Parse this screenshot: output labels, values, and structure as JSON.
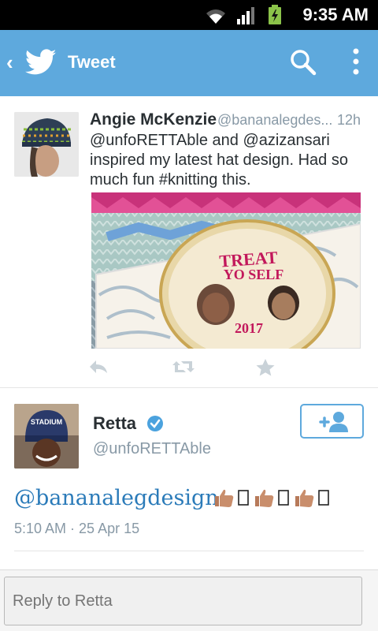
{
  "status_bar": {
    "time": "9:35 AM"
  },
  "app_bar": {
    "title": "Tweet"
  },
  "tweet1": {
    "name": "Angie McKenzie",
    "handle": "@bananalegdes...",
    "time": "12h",
    "text": "@unfoRETTAble and @azizansari inspired my latest hat design. Had so much fun #knitting this.",
    "media": {
      "plaque_top": "TREAT",
      "plaque_mid": "YO SELF",
      "plaque_year": "2017"
    }
  },
  "tweet2": {
    "name": "Retta",
    "handle": "@unfoRETTAble",
    "text": "@bananalegdesign",
    "timestamp": "5:10 AM · 25 Apr 15",
    "avatar_text": "STADIUM"
  },
  "reply": {
    "placeholder": "Reply to Retta"
  },
  "colors": {
    "app_bar": "#5ea9dd",
    "link": "#2b7bb9",
    "muted": "#8899a6"
  }
}
